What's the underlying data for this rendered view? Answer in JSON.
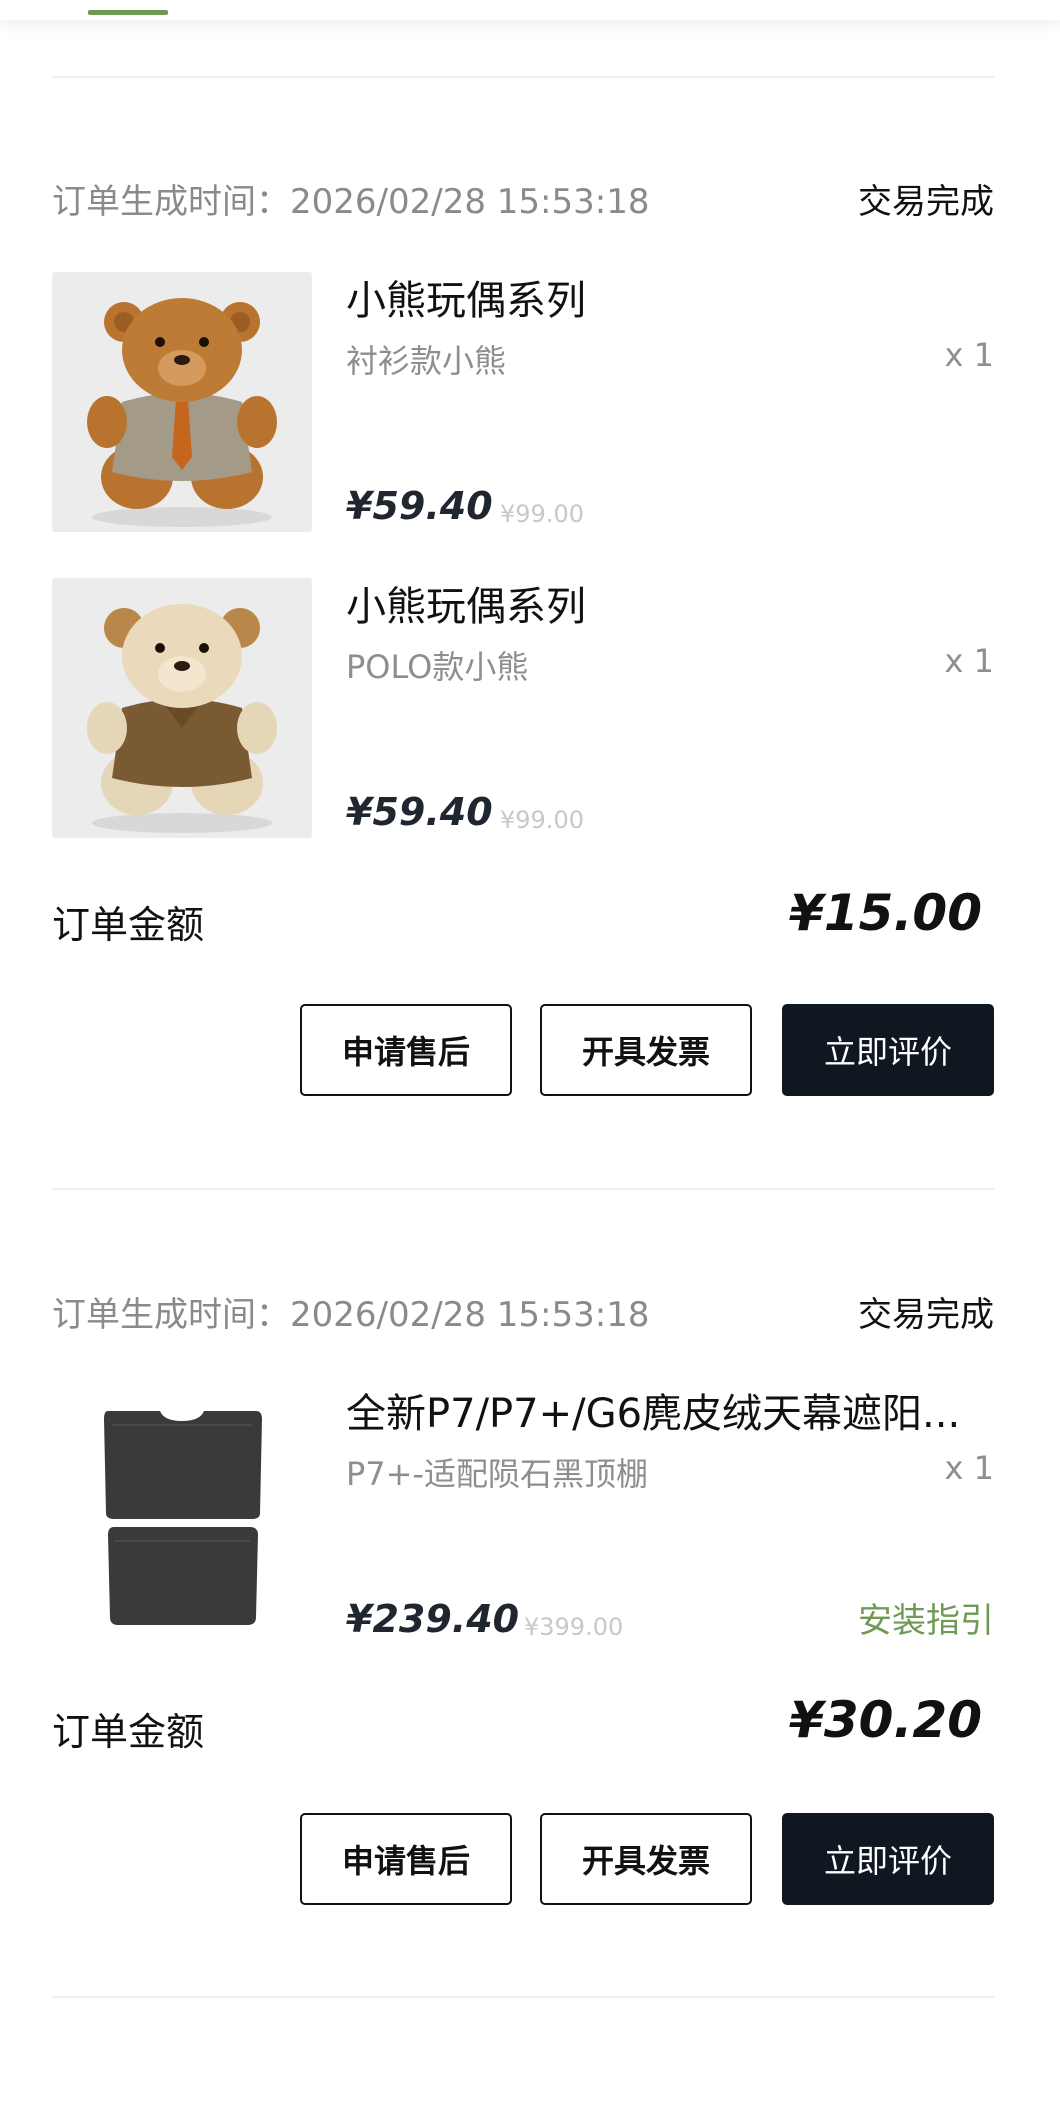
{
  "tabs": {
    "active_indicator_color": "#6f9a55"
  },
  "orders": [
    {
      "time_label": "订单生成时间：2026/02/28 15:53:18",
      "status": "交易完成",
      "items": [
        {
          "name": "小熊玩偶系列",
          "spec": "衬衫款小熊",
          "qty": "x 1",
          "price": "¥59.40",
          "original_price": "¥99.00",
          "image": "teddy-bear-brown-shirt-tie"
        },
        {
          "name": "小熊玩偶系列",
          "spec": "POLO款小熊",
          "qty": "x 1",
          "price": "¥59.40",
          "original_price": "¥99.00",
          "image": "teddy-bear-beige-polo"
        }
      ],
      "total_label": "订单金额",
      "total_amount": "¥15.00",
      "buttons": {
        "after_sales": "申请售后",
        "invoice": "开具发票",
        "review": "立即评价"
      }
    },
    {
      "time_label": "订单生成时间：2026/02/28 15:53:18",
      "status": "交易完成",
      "items": [
        {
          "name": "全新P7/P7+/G6麂皮绒天幕遮阳...",
          "spec": "P7+-适配陨石黑顶棚",
          "qty": "x 1",
          "price": "¥239.40",
          "original_price": "¥399.00",
          "link": "安装指引",
          "image": "black-sunroof-shade-panels"
        }
      ],
      "total_label": "订单金额",
      "total_amount": "¥30.20",
      "buttons": {
        "after_sales": "申请售后",
        "invoice": "开具发票",
        "review": "立即评价"
      }
    }
  ],
  "colors": {
    "accent_green": "#6f9a55",
    "primary_button": "#0f1720",
    "muted_text": "#8a8a8a"
  }
}
